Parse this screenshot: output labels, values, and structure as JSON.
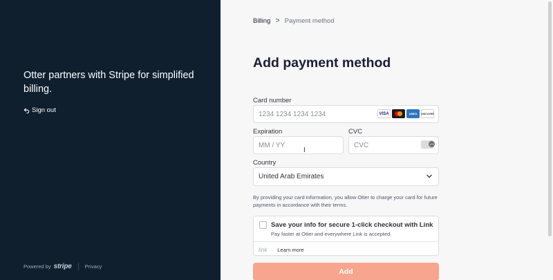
{
  "left_panel": {
    "tagline": "Otter partners with Stripe for simplified billing.",
    "sign_out_label": "Sign out",
    "footer": {
      "powered_by": "Powered by",
      "stripe": "stripe",
      "privacy": "Privacy"
    }
  },
  "breadcrumb": {
    "billing": "Billing",
    "separator": ">",
    "current": "Payment method"
  },
  "title": "Add payment method",
  "form": {
    "card_number": {
      "label": "Card number",
      "placeholder": "1234 1234 1234 1234",
      "brands": [
        "VISA",
        "mastercard",
        "AMEX",
        "DISCOVER"
      ]
    },
    "expiration": {
      "label": "Expiration",
      "placeholder": "MM / YY"
    },
    "cvc": {
      "label": "CVC",
      "placeholder": "CVC",
      "icon_text": "123"
    },
    "country": {
      "label": "Country",
      "value": "United Arab Emirates"
    }
  },
  "consent_text": "By providing your card information, you allow Otter to charge your card for future payments in accordance with their terms.",
  "link_box": {
    "heading": "Save your info for secure 1-click checkout with Link",
    "subtext": "Pay faster at Otter and everywhere Link is accepted.",
    "brand": "link",
    "dot": "·",
    "learn_more": "Learn more"
  },
  "submit_label": "Add",
  "colors": {
    "left_bg": "#0f1f2e",
    "right_bg": "#f7f7f7",
    "button_bg": "#f7a58e"
  }
}
